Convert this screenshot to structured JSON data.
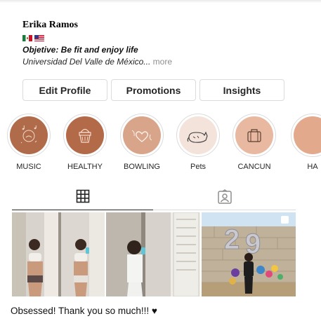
{
  "profile": {
    "name": "Erika Ramos",
    "objective": "Objetive: Be fit and enjoy life",
    "university": "Universidad Del Valle de México...",
    "more": "more",
    "flags": [
      "mexico-flag",
      "usa-flag"
    ]
  },
  "actions": {
    "edit_profile": "Edit Profile",
    "promotions": "Promotions",
    "insights": "Insights"
  },
  "highlights": [
    {
      "label": "MUSIC",
      "icon": "music-notes-icon",
      "color": "#b06b4a"
    },
    {
      "label": "HEALTHY",
      "icon": "cupcake-icon",
      "color": "#b36a49"
    },
    {
      "label": "BOWLING",
      "icon": "heart-icon",
      "color": "#d9a58a"
    },
    {
      "label": "Pets",
      "icon": "cat-icon",
      "color": "#f3e3da"
    },
    {
      "label": "CANCUN",
      "icon": "suitcase-icon",
      "color": "#e8b9a0"
    },
    {
      "label": "HA",
      "icon": "highlight-icon",
      "color": "#e3a98c"
    }
  ],
  "tabs": {
    "active": "posts",
    "items": [
      "grid-icon",
      "tagged-icon"
    ]
  },
  "caption": "Obsessed! Thank you so much!!! ♥",
  "colors": {
    "border": "#dbdbdb",
    "text": "#262626",
    "muted": "#8e8e8e"
  }
}
